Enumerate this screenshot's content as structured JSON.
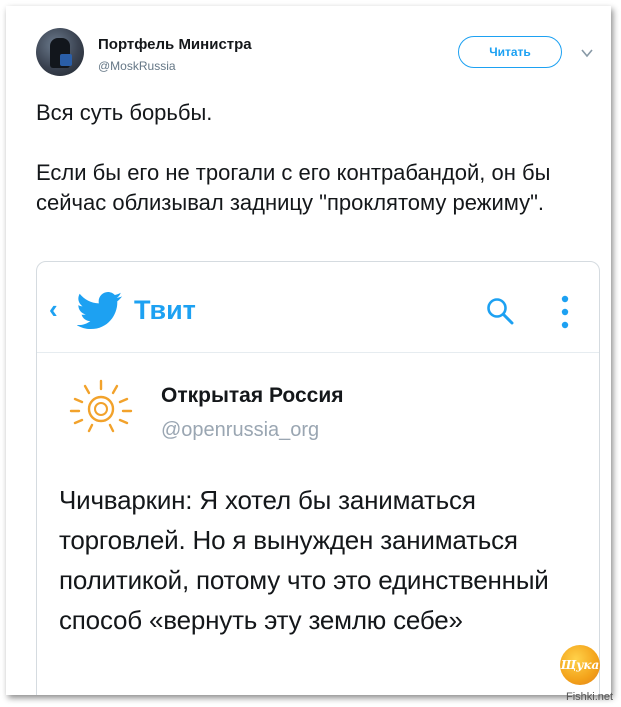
{
  "tweet": {
    "author_name": "Портфель Министра",
    "author_handle": "@MoskRussia",
    "follow_label": "Читать",
    "text_line1": "Вся суть борьбы.",
    "text_para2": "Если бы его не трогали с его контрабандой, он бы сейчас облизывал задницу \"проклятому режиму\"."
  },
  "embedded_screenshot": {
    "back_icon": "chevron-left-icon",
    "brand_icon": "twitter-bird-icon",
    "bar_title": "Твит",
    "search_icon": "search-icon",
    "more_icon": "more-vertical-icon",
    "original_author_name": "Открытая Россия",
    "original_author_handle": "@openrussia_org",
    "original_text": "Чичваркин: Я хотел бы заниматься торговлей. Но я вынужден заниматься политикой, потому что это единственный способ «вернуть эту землю себе»"
  },
  "watermark": {
    "logo_text": "Щука",
    "site": "Fishki.net"
  },
  "colors": {
    "accent": "#1da1f2",
    "text": "#14171a",
    "muted": "#657786"
  }
}
